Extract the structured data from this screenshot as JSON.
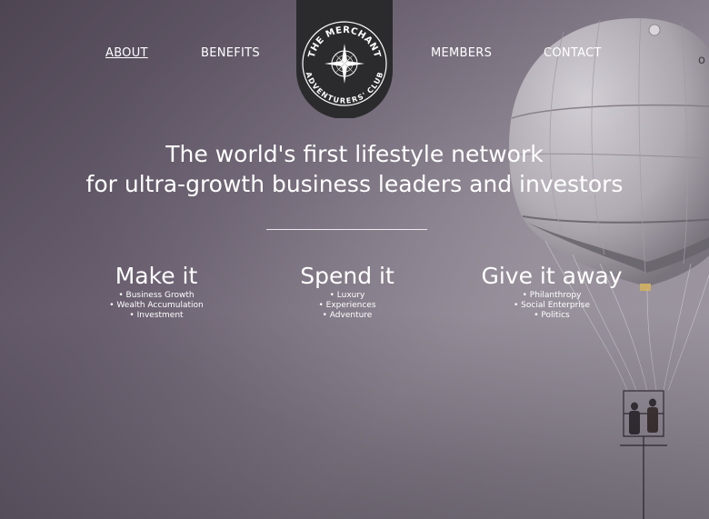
{
  "nav": {
    "about": "ABOUT",
    "benefits": "BENEFITS",
    "members": "MEMBERS",
    "contact": "CONTACT"
  },
  "logo": {
    "top_text": "THE MERCHANT",
    "bottom_text": "ADVENTURERS' CLUB",
    "icon": "compass-icon"
  },
  "hero": {
    "headline_line1": "The world's first lifestyle network",
    "headline_line2": "for ultra-growth business leaders and investors"
  },
  "columns": [
    {
      "title": "Make it",
      "items": [
        "• Business Growth",
        "• Wealth Accumulation",
        "• Investment"
      ]
    },
    {
      "title": "Spend it",
      "items": [
        "• Luxury",
        "• Experiences",
        "• Adventure"
      ]
    },
    {
      "title": "Give it away",
      "items": [
        "• Philanthropy",
        "• Social Enterprise",
        "• Politics"
      ]
    }
  ],
  "colors": {
    "background": "#6a6070",
    "badge": "#2b2b2d",
    "text": "#ffffff"
  }
}
